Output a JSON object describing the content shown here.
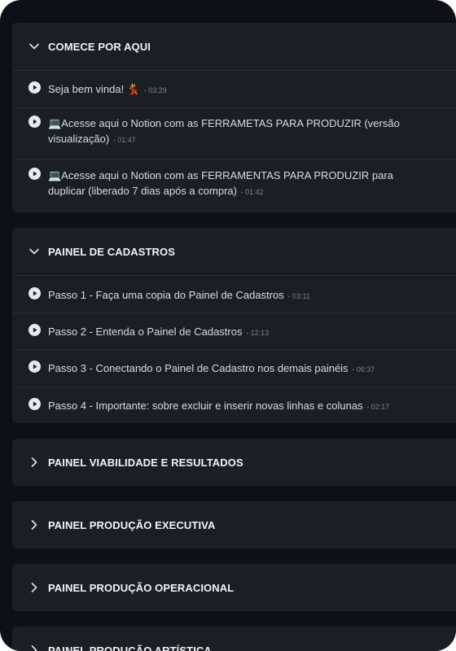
{
  "modules": [
    {
      "title": "COMECE POR AQUI",
      "expanded": true,
      "lessons": [
        {
          "title": "Seja bem vinda! 💃",
          "duration": "03:29"
        },
        {
          "title": "💻Acesse aqui o Notion com as FERRAMETAS PARA PRODUZIR (versão visualização)",
          "duration": "01:47"
        },
        {
          "title": "💻Acesse aqui o Notion com as FERRAMENTAS PARA PRODUZIR para duplicar (liberado 7 dias após a compra)",
          "duration": "01:42"
        }
      ]
    },
    {
      "title": "PAINEL DE CADASTROS",
      "expanded": true,
      "lessons": [
        {
          "title": "Passo 1 - Faça uma copia do Painel de Cadastros",
          "duration": "03:11"
        },
        {
          "title": "Passo 2 - Entenda o Painel de Cadastros",
          "duration": "12:13"
        },
        {
          "title": "Passo 3 - Conectando o Painel de Cadastro nos demais painéis",
          "duration": "06:37"
        },
        {
          "title": "Passo 4 - Importante: sobre excluir e inserir novas linhas e colunas",
          "duration": "02:17"
        }
      ]
    },
    {
      "title": "PAINEL VIABILIDADE E RESULTADOS",
      "expanded": false
    },
    {
      "title": "PAINEL PRODUÇÃO EXECUTIVA",
      "expanded": false
    },
    {
      "title": "PAINEL PRODUÇÃO OPERACIONAL",
      "expanded": false
    },
    {
      "title": "PAINEL PRODUÇÃO ARTÍSTICA",
      "expanded": false
    }
  ],
  "icons": {
    "expanded": "chevron-down-icon",
    "collapsed": "chevron-right-icon",
    "lesson": "play-circle-icon"
  },
  "colors": {
    "background": "#0d1117",
    "card": "#1a1f25",
    "text": "#d9dde2",
    "muted": "#7b838d"
  }
}
